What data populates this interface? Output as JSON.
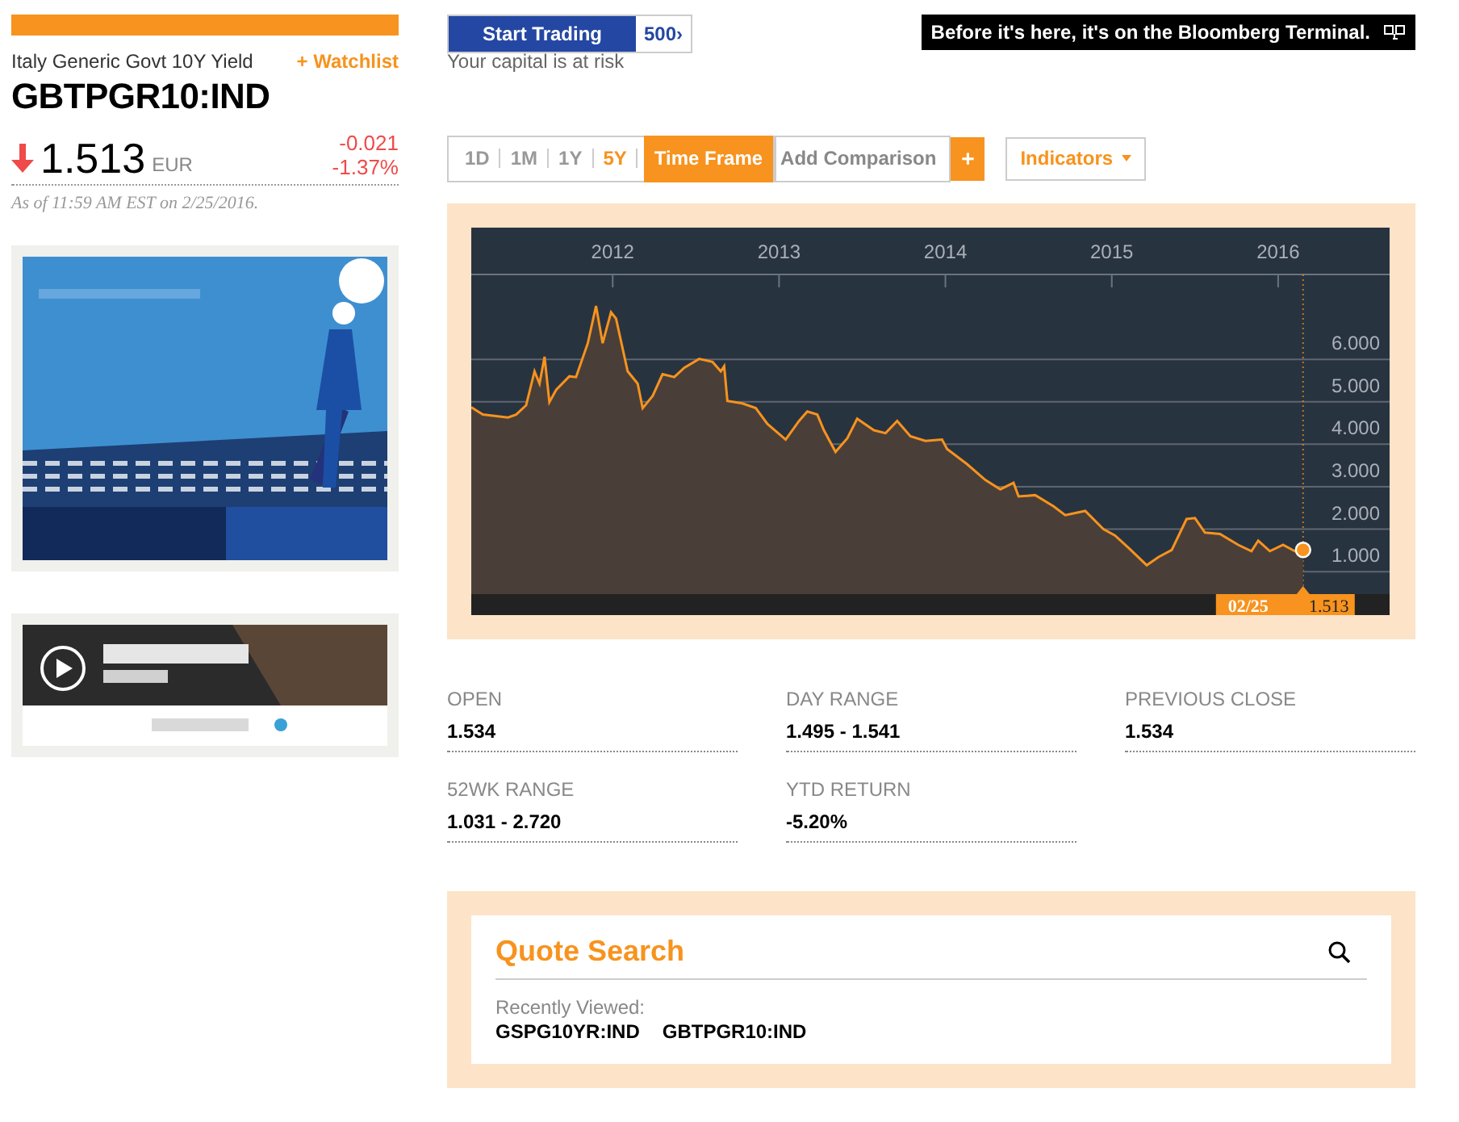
{
  "security": {
    "name": "Italy Generic Govt 10Y Yield",
    "watchlist": "+ Watchlist",
    "ticker": "GBTPGR10:IND",
    "falling": true,
    "price": "1.513",
    "currency": "EUR",
    "change": "-0.021",
    "change_pct": "-1.37%",
    "as_of": "As of 11:59 AM EST on 2/25/2016."
  },
  "trading_ad": {
    "button": "Start Trading",
    "badge": "500›",
    "note": "Your capital is at risk"
  },
  "banner": {
    "text": "Before it's here, it's on the Bloomberg Terminal."
  },
  "toolbar": {
    "timeframes": [
      {
        "label": "1D",
        "selected": false
      },
      {
        "label": "1M",
        "selected": false
      },
      {
        "label": "1Y",
        "selected": false
      },
      {
        "label": "5Y",
        "selected": true
      }
    ],
    "timeframe_button": "Time Frame",
    "comparison": "Add Comparison",
    "add": "+",
    "indicators": "Indicators"
  },
  "chart": {
    "chart_data": {
      "type": "area",
      "grid": true,
      "ref_lines": [
        {
          "axis": "x",
          "value": 2016.15
        }
      ],
      "xlim": [
        2011.15,
        2016.67
      ],
      "ylim": [
        0.47,
        8.0
      ],
      "xticks": [
        2012,
        2013,
        2014,
        2015,
        2016
      ],
      "yticks": [
        {
          "value": 1,
          "label": "1.000"
        },
        {
          "value": 2,
          "label": "2.000"
        },
        {
          "value": 3,
          "label": "3.000"
        },
        {
          "value": 4,
          "label": "4.000"
        },
        {
          "value": 5,
          "label": "5.000"
        },
        {
          "value": 6,
          "label": "6.000"
        }
      ],
      "x": [
        2011.15,
        2011.22,
        2011.37,
        2011.42,
        2011.48,
        2011.53,
        2011.56,
        2011.59,
        2011.62,
        2011.66,
        2011.74,
        2011.78,
        2011.85,
        2011.9,
        2011.94,
        2011.99,
        2012.02,
        2012.09,
        2012.15,
        2012.18,
        2012.24,
        2012.3,
        2012.37,
        2012.43,
        2012.52,
        2012.6,
        2012.65,
        2012.67,
        2012.69,
        2012.78,
        2012.86,
        2012.93,
        2013.04,
        2013.12,
        2013.17,
        2013.23,
        2013.27,
        2013.34,
        2013.41,
        2013.47,
        2013.57,
        2013.64,
        2013.71,
        2013.79,
        2013.88,
        2013.98,
        2014.01,
        2014.13,
        2014.24,
        2014.33,
        2014.41,
        2014.44,
        2014.54,
        2014.65,
        2014.72,
        2014.84,
        2014.95,
        2015.02,
        2015.1,
        2015.21,
        2015.28,
        2015.36,
        2015.45,
        2015.5,
        2015.56,
        2015.65,
        2015.76,
        2015.84,
        2015.88,
        2015.95,
        2016.03,
        2016.1,
        2016.15
      ],
      "series": [
        {
          "color": "#f7931e",
          "values": [
            4.87,
            4.7,
            4.63,
            4.7,
            4.92,
            5.72,
            5.43,
            6.06,
            4.99,
            5.28,
            5.6,
            5.58,
            6.38,
            7.26,
            6.38,
            7.11,
            6.96,
            5.72,
            5.43,
            4.85,
            5.14,
            5.65,
            5.58,
            5.8,
            6.01,
            5.94,
            5.72,
            5.84,
            5.02,
            4.96,
            4.85,
            4.48,
            4.11,
            4.55,
            4.77,
            4.7,
            4.33,
            3.82,
            4.14,
            4.6,
            4.33,
            4.26,
            4.55,
            4.19,
            4.08,
            4.11,
            3.89,
            3.53,
            3.16,
            2.94,
            3.09,
            2.77,
            2.8,
            2.54,
            2.33,
            2.43,
            2.0,
            1.85,
            1.56,
            1.15,
            1.34,
            1.51,
            2.24,
            2.26,
            1.92,
            1.89,
            1.63,
            1.48,
            1.73,
            1.48,
            1.63,
            1.48,
            1.51
          ]
        }
      ]
    },
    "last_date": "02/25",
    "last_value": "1.513"
  },
  "stats": [
    {
      "label": "OPEN",
      "value": "1.534"
    },
    {
      "label": "DAY RANGE",
      "value": "1.495 - 1.541"
    },
    {
      "label": "PREVIOUS CLOSE",
      "value": "1.534"
    },
    {
      "label": "52WK RANGE",
      "value": "1.031 - 2.720"
    },
    {
      "label": "YTD RETURN",
      "value": "-5.20%"
    }
  ],
  "quote_search": {
    "title": "Quote Search",
    "recent_label": "Recently Viewed:",
    "recent": [
      "GSPG10YR:IND",
      "GBTPGR10:IND"
    ]
  }
}
